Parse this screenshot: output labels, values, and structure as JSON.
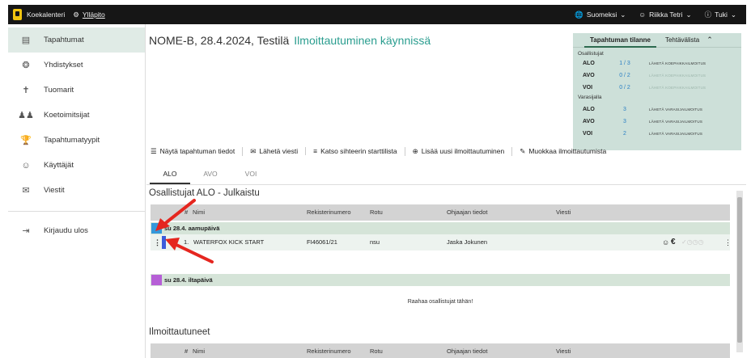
{
  "topbar": {
    "app_title": "Koekalenteri",
    "admin_label": "Ylläpito",
    "language": "Suomeksi",
    "user": "Riikka Tetri",
    "help": "Tuki"
  },
  "sidebar": {
    "items": [
      {
        "label": "Tapahtumat",
        "icon": "calendar-icon"
      },
      {
        "label": "Yhdistykset",
        "icon": "group-icon"
      },
      {
        "label": "Tuomarit",
        "icon": "judge-icon"
      },
      {
        "label": "Koetoimitsijat",
        "icon": "people-icon"
      },
      {
        "label": "Tapahtumatyypit",
        "icon": "trophy-icon"
      },
      {
        "label": "Käyttäjät",
        "icon": "user-icon"
      },
      {
        "label": "Viestit",
        "icon": "mail-icon"
      }
    ],
    "logout": "Kirjaudu ulos"
  },
  "page": {
    "title": "NOME-B, 28.4.2024, Testilä",
    "status": "Ilmoittautuminen käynnissä"
  },
  "status_panel": {
    "tab_status": "Tapahtuman tilanne",
    "tab_tasks": "Tehtävälista",
    "participants_label": "Osallistujat",
    "participants": [
      {
        "class": "ALO",
        "count": "1 / 3",
        "action": "LÄHETÄ KOEPAIKKAILMOITUS"
      },
      {
        "class": "AVO",
        "count": "0 / 2",
        "action": "LÄHETÄ KOEPAIKKAILMOITUS"
      },
      {
        "class": "VOI",
        "count": "0 / 2",
        "action": "LÄHETÄ KOEPAIKKAILMOITUS"
      }
    ],
    "reserve_label": "Varasijalla",
    "reserve": [
      {
        "class": "ALO",
        "count": "3",
        "action": "LÄHETÄ VARASIJAILMOITUS"
      },
      {
        "class": "AVO",
        "count": "3",
        "action": "LÄHETÄ VARASIJAILMOITUS"
      },
      {
        "class": "VOI",
        "count": "2",
        "action": "LÄHETÄ VARASIJAILMOITUS"
      }
    ]
  },
  "actions": [
    "Näytä tapahtuman tiedot",
    "Lähetä viesti",
    "Katso sihteerin starttilista",
    "Lisää uusi ilmoittautuminen",
    "Muokkaa ilmoittautumista"
  ],
  "tabs": [
    "ALO",
    "AVO",
    "VOI"
  ],
  "participants_section": {
    "heading": "Osallistujat ALO - Julkaistu",
    "columns": [
      "#",
      "Nimi",
      "Rekisterinumero",
      "Rotu",
      "Ohjaajan tiedot",
      "Viesti"
    ],
    "groups": [
      {
        "label": "su 28.4. aamupäivä",
        "color": "#3498db"
      },
      {
        "label": "su 28.4. iltapäivä",
        "color": "#b65fd6"
      }
    ],
    "row": {
      "number": "1.",
      "name": "WATERFOX KICK START",
      "reg": "FI46061/21",
      "breed": "nsu",
      "handler": "Jaska Jokunen"
    },
    "drop_hint": "Raahaa osallistujat tähän!"
  },
  "registered_section": {
    "heading": "Ilmoittautuneet",
    "columns": [
      "#",
      "Nimi",
      "Rekisterinumero",
      "Rotu",
      "Ohjaajan tiedot",
      "Viesti"
    ]
  },
  "colors": {
    "topbar": "#161616",
    "accent": "#2a9d8f",
    "panel": "#cde0d9",
    "group_row": "#d5e4d8",
    "arrow": "#e5261f"
  }
}
